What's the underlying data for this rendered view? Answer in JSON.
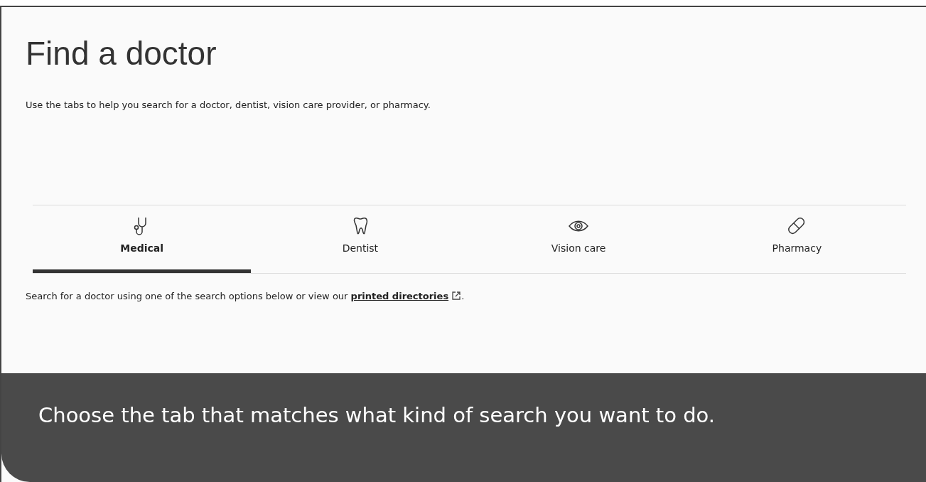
{
  "page": {
    "title": "Find a doctor",
    "subtitle": "Use the tabs to help you search for a doctor, dentist, vision care provider, or pharmacy."
  },
  "tabs": [
    {
      "label": "Medical",
      "selected": true
    },
    {
      "label": "Dentist",
      "selected": false
    },
    {
      "label": "Vision care",
      "selected": false
    },
    {
      "label": "Pharmacy",
      "selected": false
    }
  ],
  "search_note": {
    "before": "Search for a doctor using one of the search options below or view our",
    "link": "printed directories",
    "after": "."
  },
  "caption": "Choose the tab that matches what kind of search you want to do."
}
